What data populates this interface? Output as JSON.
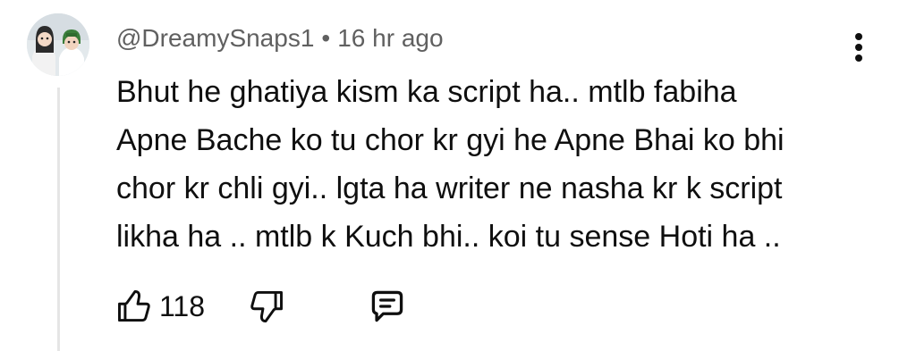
{
  "comment": {
    "author": "@DreamySnaps1",
    "separator": "•",
    "time": "16 hr ago",
    "lines": [
      "Bhut he ghatiya kism ka script ha.. mtlb fabiha",
      "Apne Bache ko tu chor kr gyi he Apne Bhai ko bhi",
      "chor kr chli gyi.. lgta ha writer ne nasha kr k script",
      "likha ha .. mtlb k Kuch bhi.. koi tu sense Hoti ha .."
    ],
    "like_count": "118"
  },
  "icons": {
    "avatar": "avatar-image",
    "menu": "more-vert-icon",
    "like": "thumb-up-icon",
    "dislike": "thumb-down-icon",
    "reply": "comment-reply-icon"
  },
  "colors": {
    "text": "#0f0f0f",
    "meta": "#606060",
    "thread_line": "#e5e5e5",
    "background": "#ffffff"
  }
}
